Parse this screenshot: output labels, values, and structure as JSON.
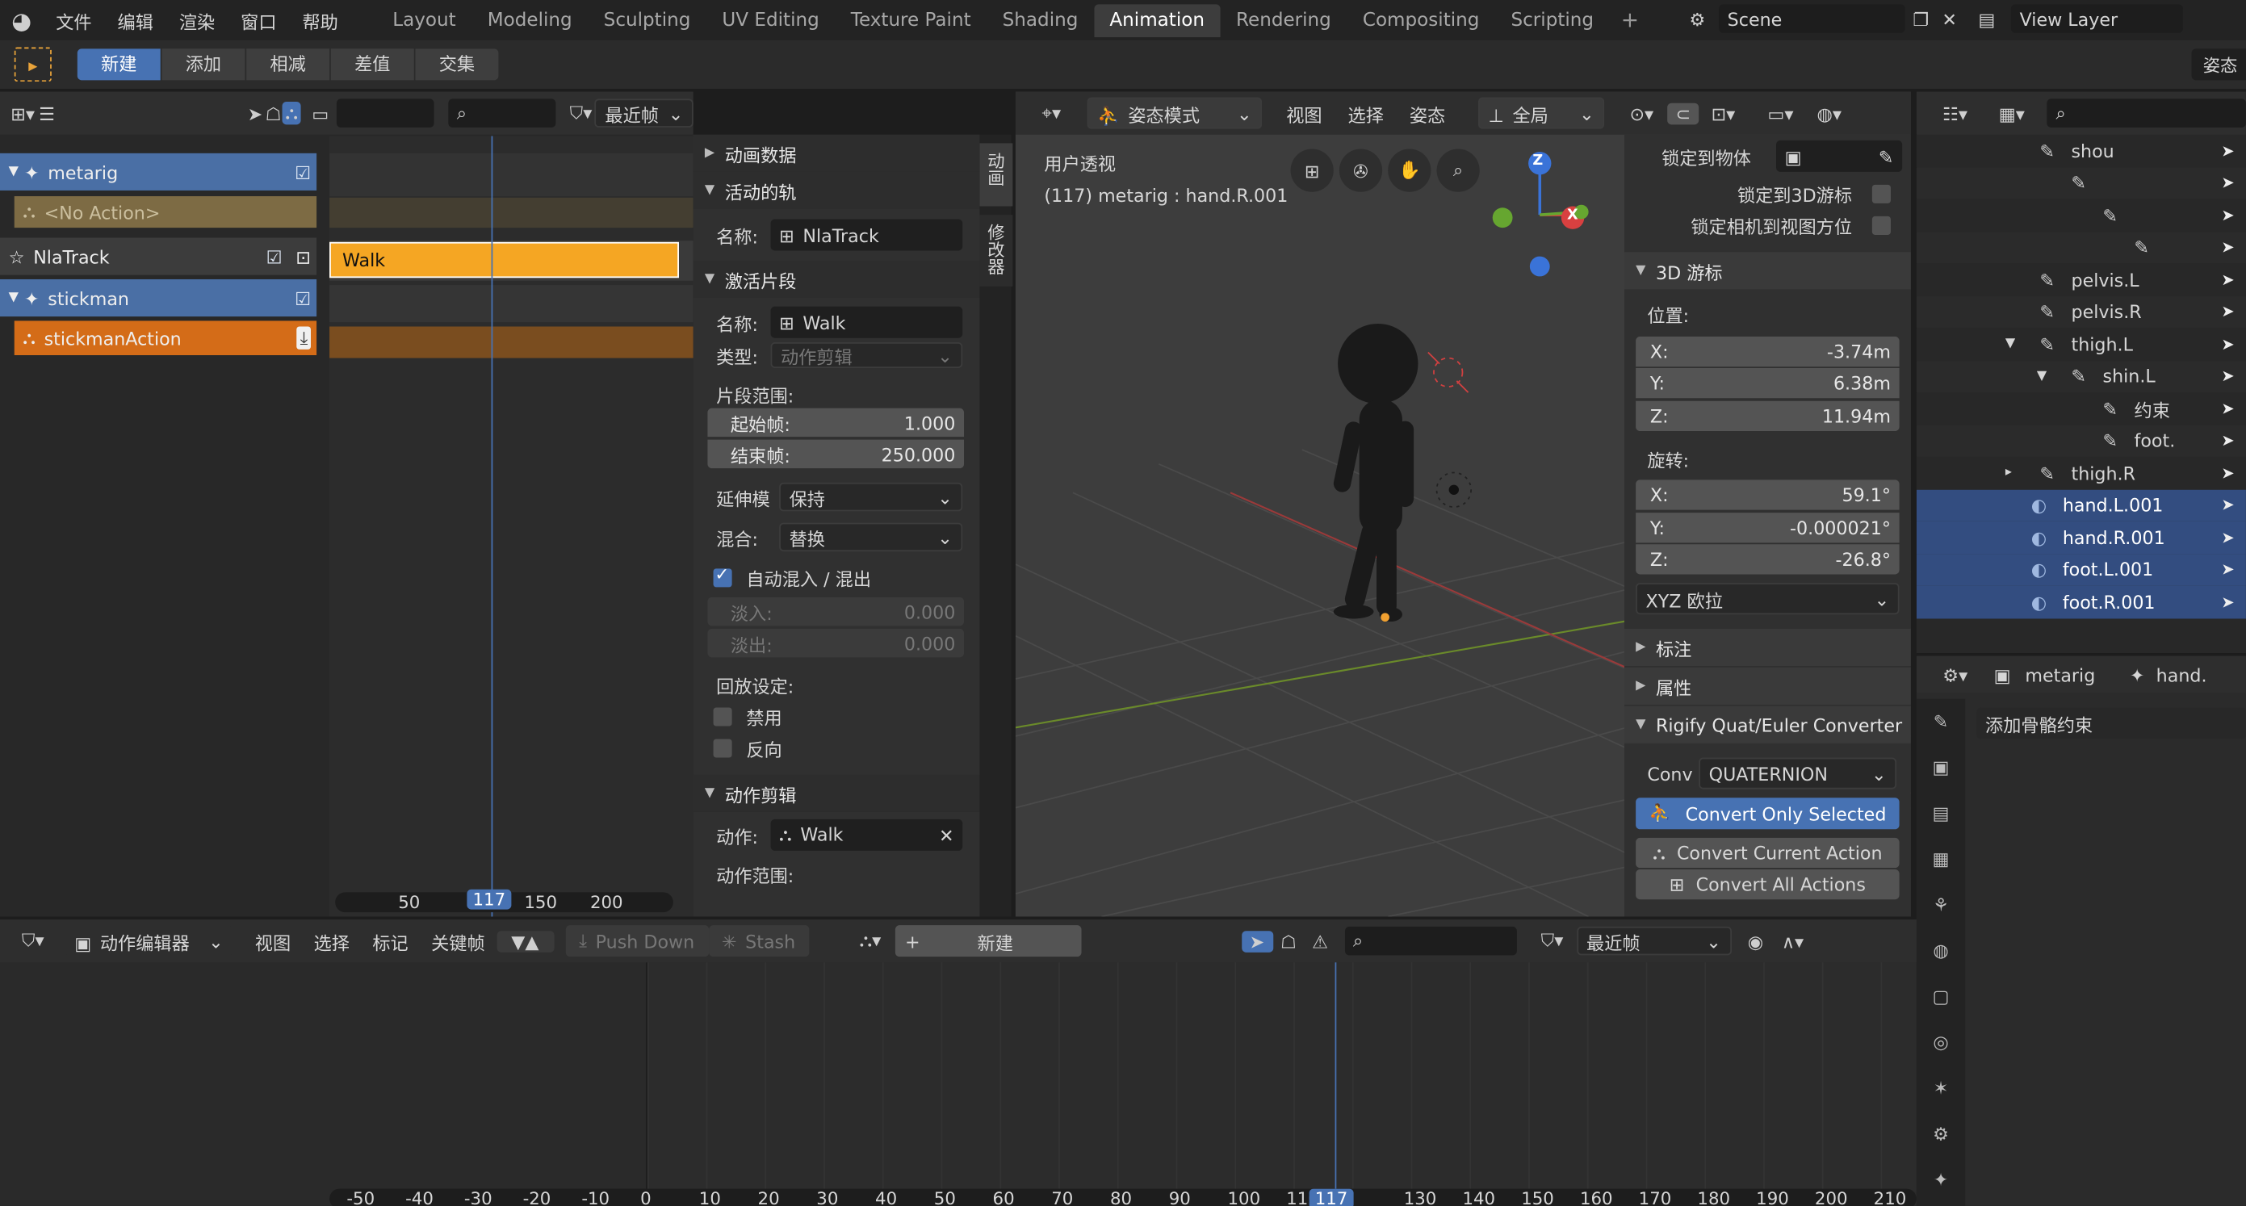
{
  "topbar": {
    "menus": [
      "文件",
      "编辑",
      "渲染",
      "窗口",
      "帮助"
    ],
    "workspaces": [
      "Layout",
      "Modeling",
      "Sculpting",
      "UV Editing",
      "Texture Paint",
      "Shading",
      "Animation",
      "Rendering",
      "Compositing",
      "Scripting"
    ],
    "active_workspace": "Animation",
    "add_tab": "+",
    "scene": "Scene",
    "view_layer": "View Layer"
  },
  "toolbar2": {
    "modes": [
      "新建",
      "添加",
      "相减",
      "差值",
      "交集"
    ],
    "active": "新建",
    "right_label": "姿态"
  },
  "nla": {
    "channels": [
      {
        "name": "metarig",
        "type": "object"
      },
      {
        "name": "<No Action>",
        "type": "noaction"
      },
      {
        "name": "NlaTrack",
        "type": "track"
      },
      {
        "name": "stickman",
        "type": "object"
      },
      {
        "name": "stickmanAction",
        "type": "action"
      }
    ],
    "strip": "Walk",
    "filter_dd": "最近帧",
    "ruler": [
      "50",
      "117",
      "150",
      "200"
    ],
    "current_frame": "117"
  },
  "sidebar": {
    "sections": {
      "anim_data": "动画数据",
      "active_track": "活动的轨",
      "active_strip": "激活片段",
      "action_clip": "动作剪辑"
    },
    "track_name_label": "名称:",
    "track_name": "NlaTrack",
    "strip_name_label": "名称:",
    "strip_name": "Walk",
    "type_label": "类型:",
    "type_value": "动作剪辑",
    "range_label": "片段范围:",
    "start_label": "起始帧:",
    "start_value": "1.000",
    "end_label": "结束帧:",
    "end_value": "250.000",
    "extrap_label": "延伸模",
    "extrap_value": "保持",
    "blend_label": "混合:",
    "blend_value": "替换",
    "auto_blend": "自动混入 / 混出",
    "fade_in_label": "淡入:",
    "fade_in_value": "0.000",
    "fade_out_label": "淡出:",
    "fade_out_value": "0.000",
    "playback_label": "回放设定:",
    "mute": "禁用",
    "reverse": "反向",
    "action_label": "动作:",
    "action_value": "Walk",
    "action_range": "动作范围:",
    "tabs": [
      "动画",
      "修改器"
    ]
  },
  "viewport": {
    "mode": "姿态模式",
    "menus": [
      "视图",
      "选择",
      "姿态"
    ],
    "orientation": "全局",
    "title": "用户透视",
    "subtitle": "(117) metarig : hand.R.001",
    "gizmo": {
      "z": "Z",
      "x": "X"
    }
  },
  "npanel": {
    "lock_object": "锁定到物体",
    "lock_cursor": "锁定到3D游标",
    "lock_camera": "锁定相机到视图方位",
    "cursor_section": "3D 游标",
    "location": "位置:",
    "loc": [
      {
        "axis": "X:",
        "value": "-3.74m"
      },
      {
        "axis": "Y:",
        "value": "6.38m"
      },
      {
        "axis": "Z:",
        "value": "11.94m"
      }
    ],
    "rotation": "旋转:",
    "rot": [
      {
        "axis": "X:",
        "value": "59.1°"
      },
      {
        "axis": "Y:",
        "value": "-0.000021°"
      },
      {
        "axis": "Z:",
        "value": "-26.8°"
      }
    ],
    "rot_mode": "XYZ 欧拉",
    "annotations": "标注",
    "properties": "属性",
    "rigify": "Rigify Quat/Euler Converter",
    "conv_label": "Conv",
    "conv_value": "QUATERNION",
    "btn_selected": "Convert Only Selected",
    "btn_current": "Convert Current Action",
    "btn_all": "Convert All Actions"
  },
  "outliner": {
    "items": [
      {
        "name": "shou",
        "indent": 0
      },
      {
        "name": "",
        "indent": 1
      },
      {
        "name": "",
        "indent": 2
      },
      {
        "name": "",
        "indent": 3
      },
      {
        "name": "pelvis.L",
        "indent": 0
      },
      {
        "name": "pelvis.R",
        "indent": 0
      },
      {
        "name": "thigh.L",
        "indent": 0
      },
      {
        "name": "shin.L",
        "indent": 1
      },
      {
        "name": "约束",
        "indent": 2
      },
      {
        "name": "foot.",
        "indent": 2
      },
      {
        "name": "thigh.R",
        "indent": 0
      },
      {
        "name": "hand.L.001",
        "indent": 0
      },
      {
        "name": "hand.R.001",
        "indent": 0
      },
      {
        "name": "foot.L.001",
        "indent": 0
      },
      {
        "name": "foot.R.001",
        "indent": 0
      }
    ]
  },
  "properties": {
    "object": "metarig",
    "bone": "hand.",
    "add_constraint": "添加骨骼约束"
  },
  "action_editor": {
    "mode": "动作编辑器",
    "menus": [
      "视图",
      "选择",
      "标记",
      "关键帧"
    ],
    "push_down": "Push Down",
    "stash": "Stash",
    "new": "新建",
    "filter_dd": "最近帧",
    "ruler": [
      "-50",
      "-40",
      "-30",
      "-20",
      "-10",
      "0",
      "10",
      "20",
      "30",
      "40",
      "50",
      "60",
      "70",
      "80",
      "90",
      "100",
      "110",
      "117",
      "130",
      "140",
      "150",
      "160",
      "170",
      "180",
      "190",
      "200",
      "210"
    ],
    "current_frame": "117"
  },
  "colors": {
    "accent": "#4772b3",
    "orange": "#e87d0d",
    "strip": "#f5a623",
    "selected_row": "#334d80"
  }
}
